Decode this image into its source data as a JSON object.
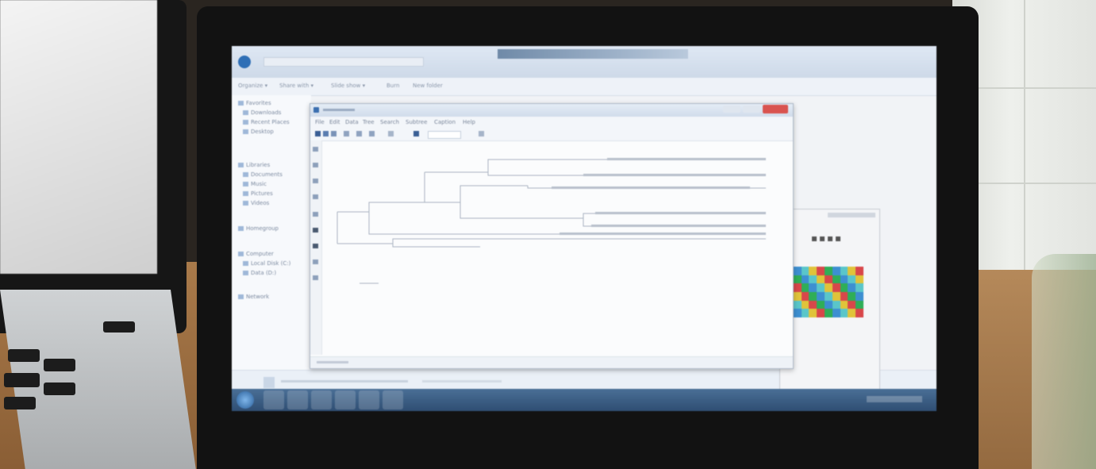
{
  "photo": {
    "description_colors": {
      "bezel": "#121212",
      "screen_bg": "#f1f3f6",
      "taskbar": "#3a5c84",
      "window_close": "#d9534f"
    }
  },
  "explorer": {
    "toolbar_items": [
      "Organize ▾",
      "Share with ▾",
      "Slide show ▾",
      "Burn",
      "New folder"
    ],
    "nav_items": [
      "Favorites",
      "Downloads",
      "Recent Places",
      "Desktop",
      "Libraries",
      "Documents",
      "Music",
      "Pictures",
      "Videos",
      "Homegroup",
      "Computer",
      "Local Disk (C:)",
      "Data (D:)",
      "Network"
    ],
    "status_text": ""
  },
  "mega": {
    "title": "",
    "menu": [
      "File",
      "Edit",
      "Data",
      "Tree",
      "Search",
      "Subtree",
      "Caption",
      "Help"
    ],
    "leaves": [
      "",
      "",
      "",
      "",
      "",
      ""
    ],
    "status": ""
  },
  "viewer": {
    "swatch_colors": [
      "#2fae57",
      "#e0c33a",
      "#3d8fd1",
      "#d8474a",
      "#5ac6c9"
    ]
  },
  "taskbar": {
    "apps": [
      "start-orb",
      "explorer-icon",
      "media-icon",
      "chrome-icon",
      "folder-icon",
      "mega-icon",
      "window-icon"
    ]
  }
}
